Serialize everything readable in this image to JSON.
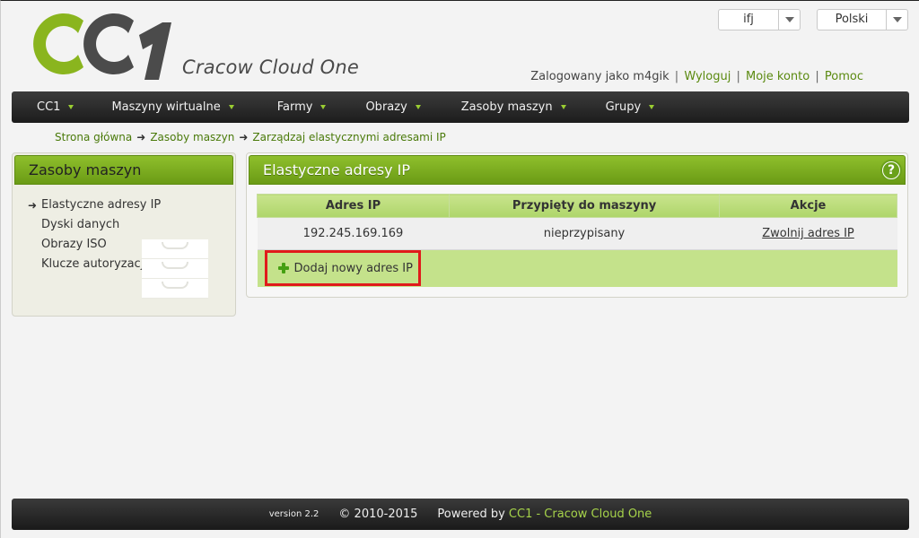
{
  "brand": {
    "name": "Cracow Cloud One"
  },
  "selectors": [
    {
      "value": "ifj"
    },
    {
      "value": "Polski"
    }
  ],
  "user": {
    "logged_as": "Zalogowany jako m4gik",
    "logout": "Wyloguj",
    "account": "Moje konto",
    "help": "Pomoc",
    "separator": "|"
  },
  "nav": [
    {
      "label": "CC1"
    },
    {
      "label": "Maszyny wirtualne"
    },
    {
      "label": "Farmy"
    },
    {
      "label": "Obrazy"
    },
    {
      "label": "Zasoby maszyn"
    },
    {
      "label": "Grupy"
    }
  ],
  "breadcrumb": [
    "Strona główna",
    "Zasoby maszyn",
    "Zarządzaj elastycznymi adresami IP"
  ],
  "sidebar": {
    "title": "Zasoby maszyn",
    "items": [
      {
        "label": "Elastyczne adresy IP",
        "active": true
      },
      {
        "label": "Dyski danych"
      },
      {
        "label": "Obrazy ISO"
      },
      {
        "label": "Klucze autoryzacji"
      }
    ]
  },
  "main": {
    "title": "Elastyczne adresy IP",
    "help_label": "?",
    "table": {
      "headers": [
        "Adres IP",
        "Przypięty do maszyny",
        "Akcje"
      ],
      "rows": [
        {
          "ip": "192.245.169.169",
          "machine": "nieprzypisany",
          "action": "Zwolnij adres IP"
        }
      ]
    },
    "add_label": "Dodaj nowy adres IP"
  },
  "footer": {
    "version": "version 2.2",
    "copyright": "© 2010-2015",
    "powered": "Powered by",
    "link": "CC1 - Cracow Cloud One"
  },
  "colors": {
    "accent": "#7cb01f",
    "link": "#5b8a10",
    "highlight_border": "#e01b1b"
  }
}
